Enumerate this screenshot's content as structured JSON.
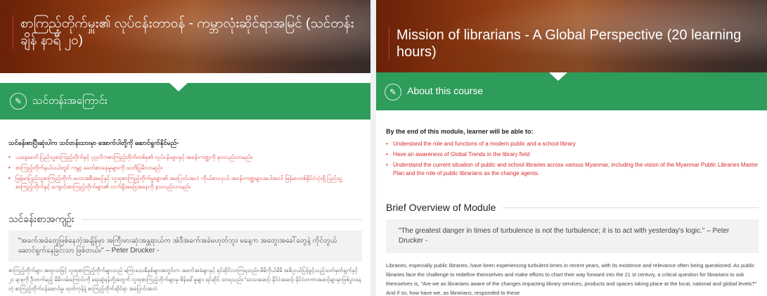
{
  "left_panel": {
    "title": "စာကြည့်တိုက်မှူး၏ လုပ်ငန်းတာဝန် - ကမ္ဘာလုံးဆိုင်ရာအမြင် (သင်တန်းချိန် နာရီ ၂၀)",
    "course_band_label": "သင်တန်းအကြောင်း",
    "objectives_heading": "သင်ခန်းစာပြီးဆုံးပါက သင်တန်းသားမှာ အောက်ပါတို့ကို ဆောင်ရွက်နိုင်မည်-",
    "objectives": [
      "ယနေ့ခေတ် ပြည်သူ့စာကြည့်တိုက်နှင့် ပုဂ္ဂလိကစာကြည့်တိုက်တစ်ခု၏ လုပ်ငန်းများနှင့် အခန်းကဏ္ဍကို နားလည်လာမည်။",
      "စာကြည့်တိုက်နယ်ပယ်တွင် ကမ္ဘာ့ ခေတ်စားနေမှုများကို သတိပြုမိလာမည်။",
      "မြန်မာပြည်သူ့စာကြည့်တိုက် မဟာအစီအစဉ်နှင့် လူထုစာကြည့်တိုက်မှူးများ၏ အပြောင်းအလဲ ကိုယ်စားလှယ် အခန်းကဏ္ဍများအပါအဝင် မြန်မာတစ်နိုင်ငံလုံးရှိ ပြည်သူ့ စာကြည့်တိုက်နှင့် ကျောင်းစာကြည့်တိုက်များ၏ လက်ရှိအခြေအနေကို နားလည်လာမည်။"
    ],
    "overview_title": "သင်ခန်းစာအကျဉ်း",
    "quote": "\"အခက်အခဲတွေဖြစ်နေတဲ့အချိန်မှာ အကြီးမားဆုံးအန္တရာယ်က အဲဒီအခက်အခဲမဟုတ်ဘူး၊ မနေ့က အတွေးအခေါ်တွေနဲ့ ကိုင်တွယ်ဆောင်ရွက်နေခြင်းသာ ဖြစ်တယ်။\" – Peter Drucker -",
    "body": "စာကြည့်တိုက်များ အထူးသဖြင့် လူထုစာကြည့်တိုက်များသည် မကြာသေးမီနှစ်များအတွင်းက အခက်အခဲများနှင့် ရင်ဆိုင်လာကြရသည်။ မိမိကိုယ်မိမိ အဓိပ္ပာယ်ပြန်ဖွင့်သည့်သတ်မှတ်ချက်နှင့် ၂၁ ရာစုကို ဦးတက်မည့် မိမိလမ်းကြောင်းကို ရေးဆွဲရန်တို့အတွက် လူထုစာကြည့်တိုက်များမှ စိန်ခေါ်မှုများ ရင်ဆိုင် သာရသည်။ \"ဒေသအဆင့်၊ နိုင်ငံအဆင့်၊ နိုင်ငံတကာအဆင့်များမှာဖြစ်ပွားနေတဲ့ စာကြည့်တိုက်ဝန်ဆောင်မှု၊ ထုတ်ကုန်နဲ့ စာကြည့်တိုက်ဆိုင်ရာ အပြောင်းအလဲ"
  },
  "right_panel": {
    "title": "Mission of librarians - A Global Perspective (20 learning hours)",
    "course_band_label": "About this course",
    "objectives_heading": "By the end of this module, learner will be able to:",
    "objectives": [
      "Understand the role and functions of a modern public and a school library",
      "Have an awareness of Global Trends in the library field",
      "Understand the current situation of public and school libraries across various Myanmar, including the vision of the Myanmar Public Libraries Master Plan and the role of public librarians as the change agents."
    ],
    "overview_title": "Brief Overview of Module",
    "quote": "\"The greatest danger in times of turbulence is not the turbulence; it is to act with yesterday's logic.\" – Peter Drucker -",
    "body": "Libraries, especially public libraries, have been experiencing turbulent times in recent years, with its existence and relevance often being questioned. As public libraries face the challenge to redefine themselves and make efforts to chart their way forward into the 21 st century, a critical question for librarians to ask themselves is, \"Are we as librarians aware of the changes impacting library services, products and spaces taking place at the local, national and global levels?\" And if so, how have we, as librarians, responded to these"
  },
  "icons": {
    "course_band_icon": "pencil-icon"
  },
  "colors": {
    "band_green": "#2e9c5a",
    "objective_red": "#d62a2a"
  }
}
